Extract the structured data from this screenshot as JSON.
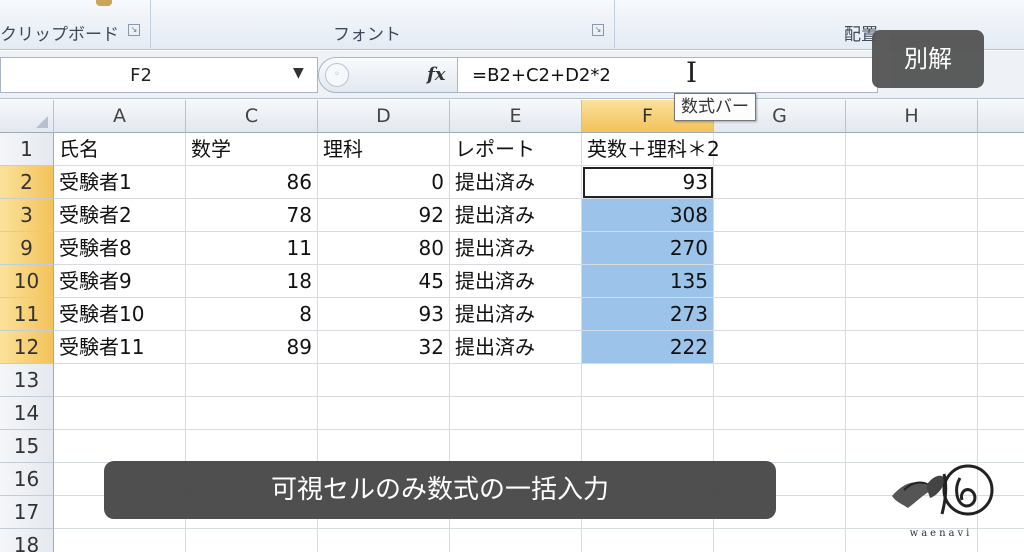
{
  "ribbon": {
    "groups": [
      {
        "label": "クリップボード",
        "x": 0
      },
      {
        "label": "フォント",
        "x": 0
      },
      {
        "label": "配置",
        "x": 0
      }
    ]
  },
  "formula_bar": {
    "name_box_value": "F2",
    "formula": "=B2+C2+D2*2",
    "fx_label": "fx",
    "tooltip": "数式バー"
  },
  "badge": "別解",
  "columns": [
    {
      "label": "A"
    },
    {
      "label": "C"
    },
    {
      "label": "D"
    },
    {
      "label": "E"
    },
    {
      "label": "F"
    },
    {
      "label": "G"
    },
    {
      "label": "H"
    }
  ],
  "header_row": {
    "row_number": "1",
    "cells": [
      "氏名",
      "数学",
      "理科",
      "レポート",
      "英数＋理科＊2",
      "",
      ""
    ]
  },
  "rows": [
    {
      "row_number": "2",
      "cells": [
        "受験者1",
        "86",
        "0",
        "提出済み",
        "93",
        "",
        ""
      ]
    },
    {
      "row_number": "3",
      "cells": [
        "受験者2",
        "78",
        "92",
        "提出済み",
        "308",
        "",
        ""
      ]
    },
    {
      "row_number": "9",
      "cells": [
        "受験者8",
        "11",
        "80",
        "提出済み",
        "270",
        "",
        ""
      ]
    },
    {
      "row_number": "10",
      "cells": [
        "受験者9",
        "18",
        "45",
        "提出済み",
        "135",
        "",
        ""
      ]
    },
    {
      "row_number": "11",
      "cells": [
        "受験者10",
        "8",
        "93",
        "提出済み",
        "273",
        "",
        ""
      ]
    },
    {
      "row_number": "12",
      "cells": [
        "受験者11",
        "89",
        "32",
        "提出済み",
        "222",
        "",
        ""
      ]
    }
  ],
  "empty_rows": [
    "13",
    "14",
    "15",
    "16",
    "17",
    "18"
  ],
  "caption": "可視セルのみ数式の一括入力",
  "logo_text": "waenavi",
  "colors": {
    "selection_fill": "#9cc3ea",
    "header_selected": "#f3c25a",
    "caption_bg": "#464646"
  }
}
